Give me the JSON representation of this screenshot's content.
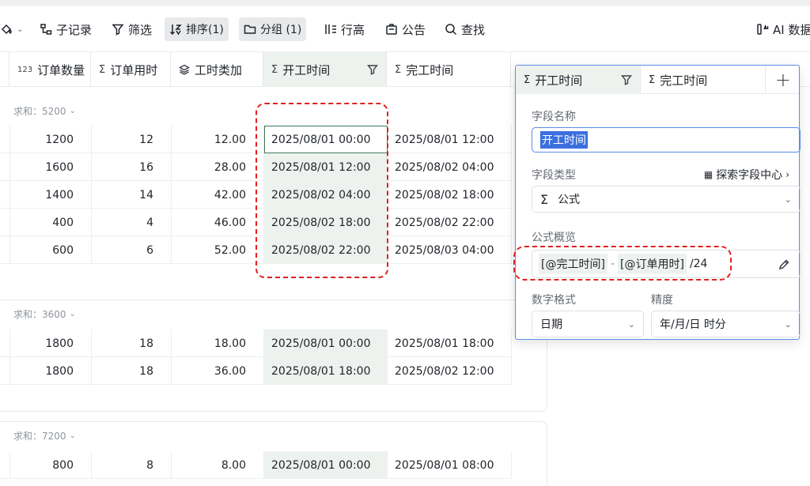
{
  "toolbar": {
    "items": [
      {
        "label": "子记录",
        "icon": "subrecord-icon"
      },
      {
        "label": "筛选",
        "icon": "filter-icon"
      },
      {
        "label": "排序(1)",
        "icon": "sort-icon"
      },
      {
        "label": "分组 (1)",
        "icon": "folder-icon"
      },
      {
        "label": "行高",
        "icon": "row-height-icon"
      },
      {
        "label": "公告",
        "icon": "announcement-icon"
      },
      {
        "label": "查找",
        "icon": "search-icon"
      },
      {
        "label": "AI 数据",
        "icon": "ai-data-icon"
      }
    ]
  },
  "columns": [
    {
      "label": "订单数量",
      "icon": "123"
    },
    {
      "label": "订单用时",
      "icon": "Σ"
    },
    {
      "label": "工时类加",
      "icon": "stack-icon"
    },
    {
      "label": "开工时间",
      "icon": "Σ"
    },
    {
      "label": "完工时间",
      "icon": "Σ"
    }
  ],
  "groups": [
    {
      "sum_label": "求和：5200",
      "rows": [
        [
          "1200",
          "12",
          "12.00",
          "2025/08/01 00:00",
          "2025/08/01 12:00"
        ],
        [
          "1600",
          "16",
          "28.00",
          "2025/08/01 12:00",
          "2025/08/02 04:00"
        ],
        [
          "1400",
          "14",
          "42.00",
          "2025/08/02 04:00",
          "2025/08/02 18:00"
        ],
        [
          "400",
          "4",
          "46.00",
          "2025/08/02 18:00",
          "2025/08/02 22:00"
        ],
        [
          "600",
          "6",
          "52.00",
          "2025/08/02 22:00",
          "2025/08/03 04:00"
        ]
      ]
    },
    {
      "sum_label": "求和：3600",
      "rows": [
        [
          "1800",
          "18",
          "18.00",
          "2025/08/01 00:00",
          "2025/08/01 18:00"
        ],
        [
          "1800",
          "18",
          "36.00",
          "2025/08/01 18:00",
          "2025/08/02 12:00"
        ]
      ]
    },
    {
      "sum_label": "求和：7200",
      "rows": [
        [
          "800",
          "8",
          "8.00",
          "2025/08/01 00:00",
          "2025/08/01 08:00"
        ]
      ]
    }
  ],
  "panel": {
    "tabs": [
      "开工时间",
      "完工时间"
    ],
    "field_name_label": "字段名称",
    "field_name_value": "开工时间",
    "field_type_label": "字段类型",
    "explore_link": "探索字段中心",
    "field_type_value": "公式",
    "formula_label": "公式概览",
    "formula_tokens": [
      "[@完工时间]",
      "-",
      "[@订单用时]",
      "/24"
    ],
    "number_format_label": "数字格式",
    "number_format_value": "日期",
    "precision_label": "精度",
    "precision_value": "年/月/日 时分"
  },
  "colors": {
    "selected_column_bg": "#edf2ef",
    "highlight_red": "#e02020",
    "panel_border": "#5a8de6",
    "text_selection": "#3b6fe0"
  }
}
